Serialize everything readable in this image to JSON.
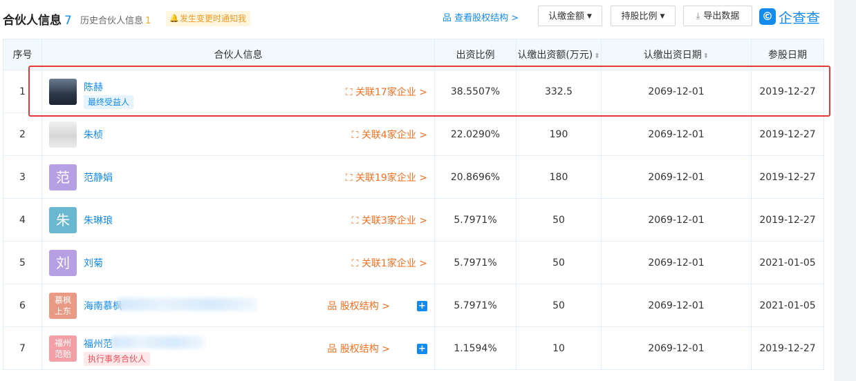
{
  "header": {
    "title": "合伙人信息",
    "count": "7",
    "history_label": "历史合伙人信息",
    "history_count": "1",
    "notify_label": "发生变更时通知我",
    "equity_link": "查看股权结构 >",
    "filter_amount": "认缴金额",
    "filter_ratio": "持股比例",
    "export_label": "导出数据",
    "logo_text": "企查查"
  },
  "columns": {
    "index": "序号",
    "info": "合伙人信息",
    "ratio": "出资比例",
    "amount": "认缴出资额(万元)",
    "date": "认缴出资日期",
    "join": "参股日期"
  },
  "rows": [
    {
      "index": "1",
      "avatar": "photo-man-suit",
      "name": "陈赫",
      "tag": "最终受益人",
      "related": "关联17家企业 >",
      "ratio": "38.5507%",
      "amount": "332.5",
      "date": "2069-12-01",
      "join": "2019-12-27"
    },
    {
      "index": "2",
      "avatar": "photo-man-white",
      "name": "朱桢",
      "tag": "",
      "related": "关联4家企业 >",
      "ratio": "22.0290%",
      "amount": "190",
      "date": "2069-12-01",
      "join": "2019-12-27"
    },
    {
      "index": "3",
      "avatar_text": "范",
      "name": "范静娟",
      "tag": "",
      "related": "关联19家企业 >",
      "ratio": "20.8696%",
      "amount": "180",
      "date": "2069-12-01",
      "join": "2019-12-27"
    },
    {
      "index": "4",
      "avatar_text": "朱",
      "name": "朱琳琅",
      "tag": "",
      "related": "关联3家企业 >",
      "ratio": "5.7971%",
      "amount": "50",
      "date": "2069-12-01",
      "join": "2019-12-27"
    },
    {
      "index": "5",
      "avatar_text": "刘",
      "name": "刘菊",
      "tag": "",
      "related": "关联1家企业 >",
      "ratio": "5.7971%",
      "amount": "50",
      "date": "2069-12-01",
      "join": "2021-01-05"
    },
    {
      "index": "6",
      "avatar_text": "慕枫上东",
      "avatar_l1": "慕枫",
      "avatar_l2": "上东",
      "name": "海南慕枫",
      "tag": "",
      "related": "股权结构 >",
      "ratio": "5.7971%",
      "amount": "50",
      "date": "2069-12-01",
      "join": "2021-01-05"
    },
    {
      "index": "7",
      "avatar_l1": "福州",
      "avatar_l2": "范贻",
      "name": "福州范",
      "tag": "执行事务合伙人",
      "related": "股权结构 >",
      "ratio": "1.1594%",
      "amount": "10",
      "date": "2069-12-01",
      "join": "2019-12-27"
    }
  ],
  "colors": {
    "accent": "#128bed",
    "link_orange": "#f36f21",
    "highlight": "#e53935"
  }
}
